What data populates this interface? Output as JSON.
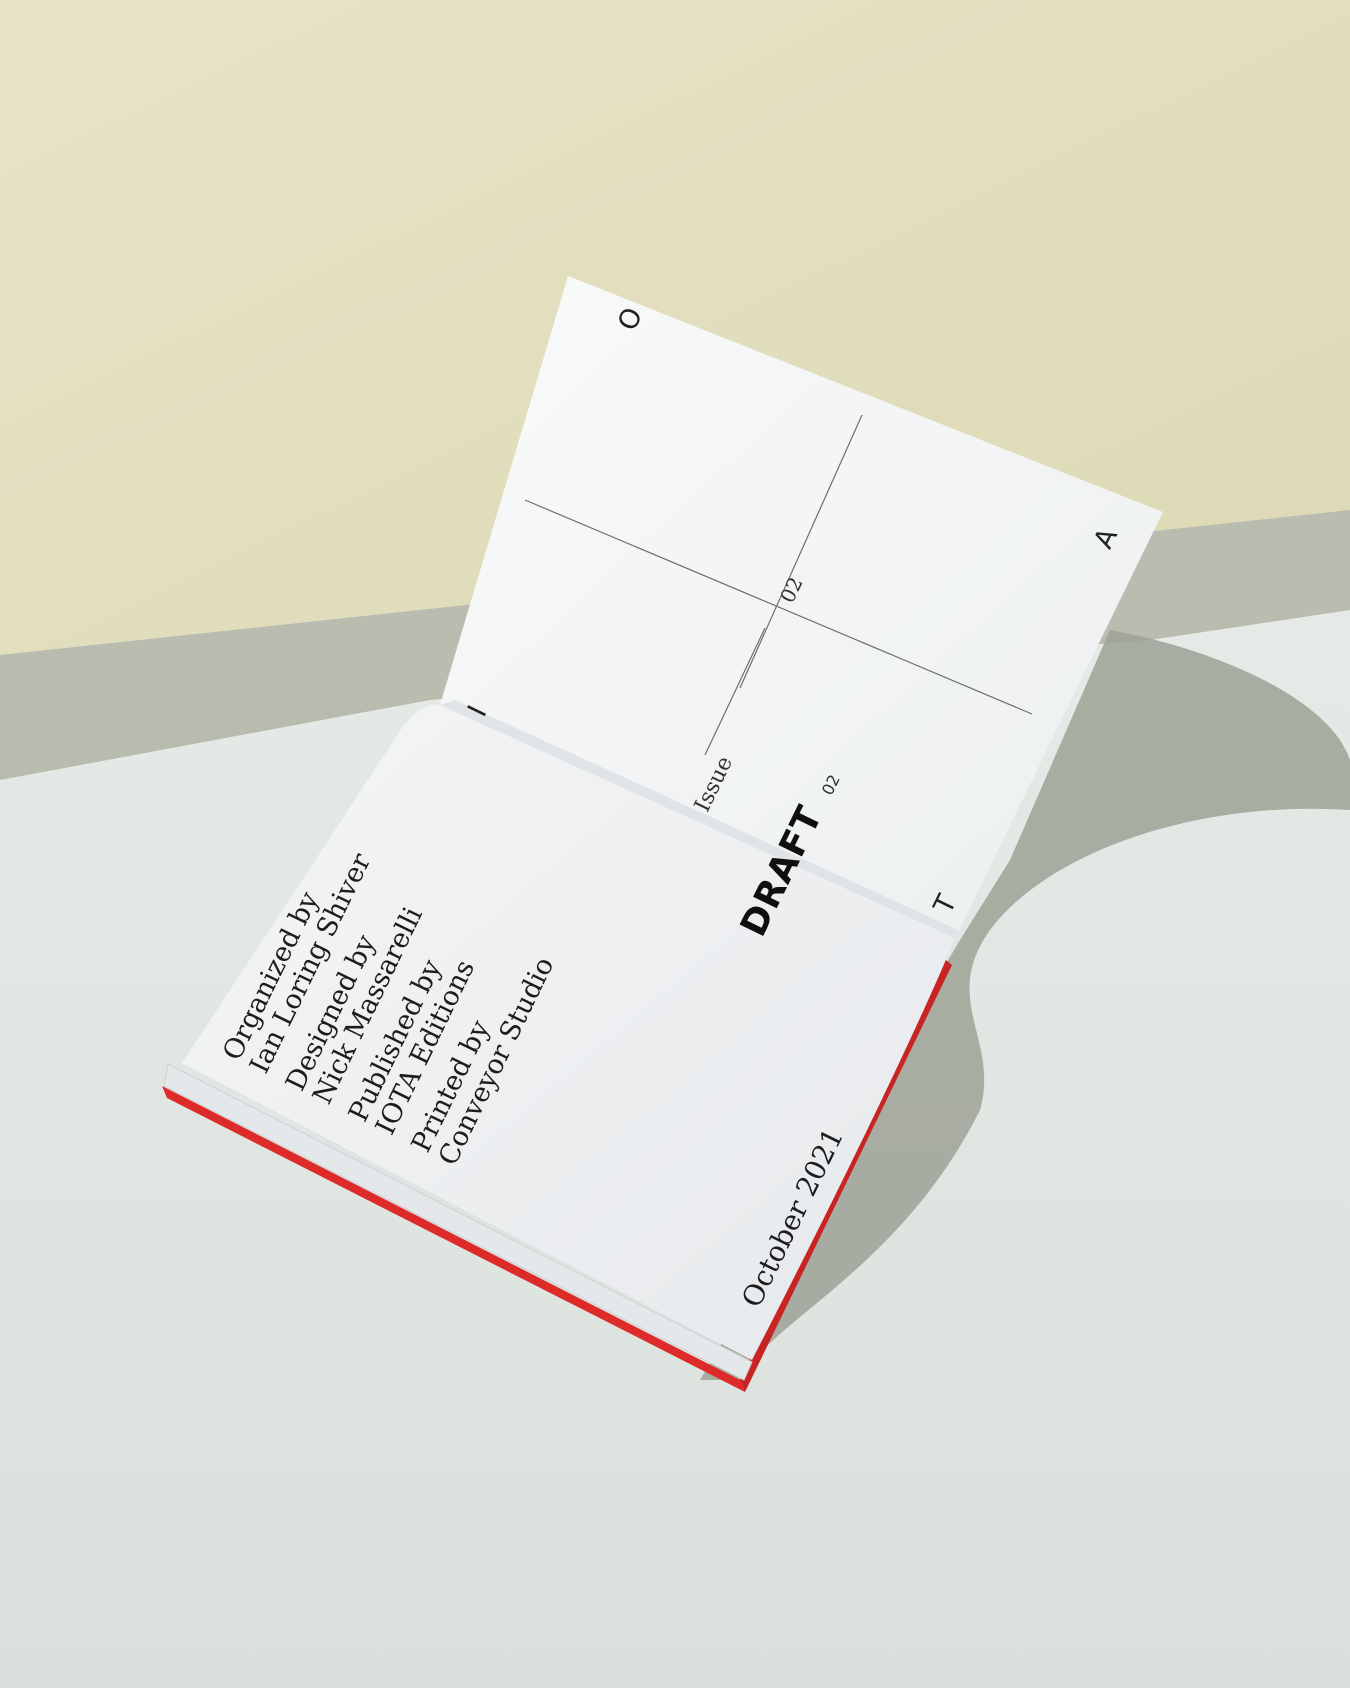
{
  "corner_letters": [
    "O",
    "A",
    "T",
    "I"
  ],
  "issue": {
    "label": "Issue",
    "number": "02"
  },
  "wordmark": {
    "text": "DRAFT",
    "number": "02"
  },
  "credits": [
    {
      "role": "Organized by",
      "name": "Ian Loring Shiver"
    },
    {
      "role": "Designed by",
      "name": "Nick Massarelli"
    },
    {
      "role": "Published by",
      "name": "IOTA Editions"
    },
    {
      "role": "Printed by",
      "name": "Conveyor Studio"
    }
  ],
  "date": "October 2021",
  "colors": {
    "backdrop_top": "#e4e0c2",
    "surface": "#e6ebe6",
    "page": "#f6f7f7",
    "edge": "#e2302e"
  }
}
